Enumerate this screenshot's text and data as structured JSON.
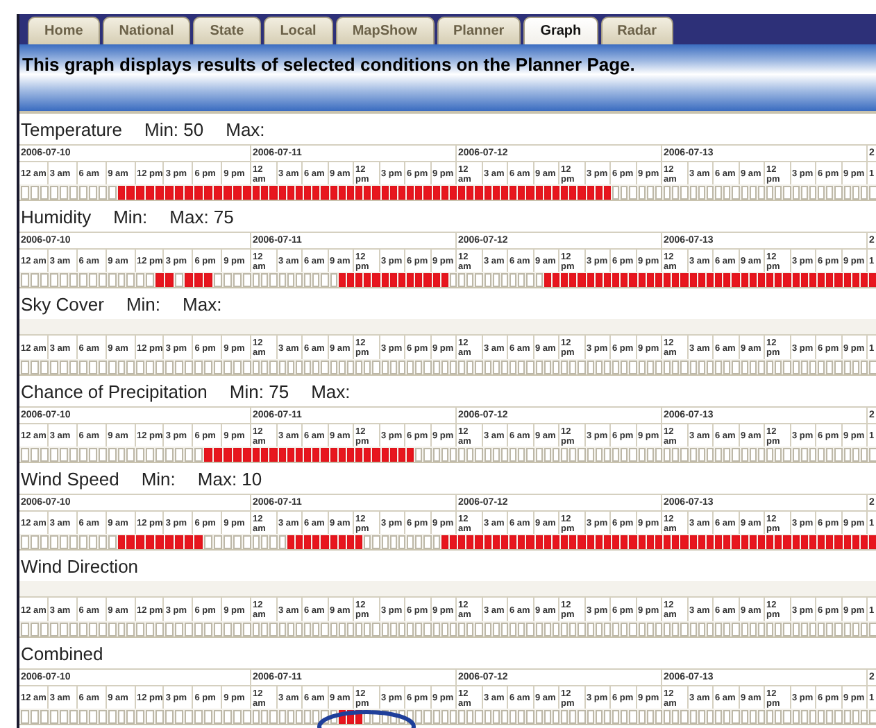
{
  "tabs": [
    {
      "label": "Home",
      "selected": false
    },
    {
      "label": "National",
      "selected": false
    },
    {
      "label": "State",
      "selected": false
    },
    {
      "label": "Local",
      "selected": false
    },
    {
      "label": "MapShow",
      "selected": false
    },
    {
      "label": "Planner",
      "selected": false
    },
    {
      "label": "Graph",
      "selected": true
    },
    {
      "label": "Radar",
      "selected": false
    }
  ],
  "banner": "This graph displays results of selected conditions on the Planner Page.",
  "conditions": [
    {
      "name": "Temperature",
      "min": "Min: 50",
      "max": "Max:",
      "days": [
        {
          "date": "2006-07-10",
          "hours": [
            "12 am",
            "3 am",
            "6 am",
            "9 am",
            "12 pm",
            "3 pm",
            "6 pm",
            "9 pm"
          ],
          "cells": [
            false,
            false,
            false,
            false,
            false,
            false,
            false,
            false,
            false,
            false,
            true,
            true,
            true,
            true,
            true,
            true,
            true,
            true,
            true,
            true,
            true,
            true,
            true,
            true
          ]
        },
        {
          "date": "2006-07-11",
          "hours": [
            "12 am",
            "3 am",
            "6 am",
            "9 am",
            "12 pm",
            "3 pm",
            "6 pm",
            "9 pm"
          ],
          "cells": [
            true,
            true,
            true,
            true,
            true,
            true,
            true,
            true,
            true,
            true,
            true,
            true,
            true,
            true,
            true,
            true,
            true,
            true,
            true,
            true,
            true,
            true,
            true,
            true
          ]
        },
        {
          "date": "2006-07-12",
          "hours": [
            "12 am",
            "3 am",
            "6 am",
            "9 am",
            "12 pm",
            "3 pm",
            "6 pm",
            "9 pm"
          ],
          "cells": [
            true,
            true,
            true,
            true,
            true,
            true,
            true,
            true,
            true,
            true,
            true,
            true,
            true,
            true,
            true,
            true,
            true,
            true,
            false,
            false,
            false,
            false,
            false,
            false
          ]
        },
        {
          "date": "2006-07-13",
          "hours": [
            "12 am",
            "3 am",
            "6 am",
            "9 am",
            "12 pm",
            "3 pm",
            "6 pm",
            "9 pm"
          ],
          "cells": [
            false,
            false,
            false,
            false,
            false,
            false,
            false,
            false,
            false,
            false,
            false,
            false,
            false,
            false,
            false,
            false,
            false,
            false,
            false,
            false,
            false,
            false,
            false,
            false
          ]
        },
        {
          "date": "2",
          "hours": [
            "1"
          ],
          "cells": [
            false
          ]
        }
      ]
    },
    {
      "name": "Humidity",
      "min": "Min:",
      "max": "Max: 75",
      "days": [
        {
          "date": "2006-07-10",
          "hours": [
            "12 am",
            "3 am",
            "6 am",
            "9 am",
            "12 pm",
            "3 pm",
            "6 pm",
            "9 pm"
          ],
          "cells": [
            false,
            false,
            false,
            false,
            false,
            false,
            false,
            false,
            false,
            false,
            false,
            false,
            false,
            false,
            true,
            true,
            false,
            true,
            true,
            true,
            false,
            false,
            false,
            false
          ]
        },
        {
          "date": "2006-07-11",
          "hours": [
            "12 am",
            "3 am",
            "6 am",
            "9 am",
            "12 pm",
            "3 pm",
            "6 pm",
            "9 pm"
          ],
          "cells": [
            false,
            false,
            false,
            false,
            false,
            false,
            false,
            false,
            false,
            false,
            true,
            true,
            true,
            true,
            true,
            true,
            true,
            true,
            true,
            true,
            true,
            true,
            true,
            false
          ]
        },
        {
          "date": "2006-07-12",
          "hours": [
            "12 am",
            "3 am",
            "6 am",
            "9 am",
            "12 pm",
            "3 pm",
            "6 pm",
            "9 pm"
          ],
          "cells": [
            false,
            false,
            false,
            false,
            false,
            false,
            false,
            false,
            false,
            false,
            true,
            true,
            true,
            true,
            true,
            true,
            true,
            true,
            true,
            true,
            true,
            true,
            true,
            true
          ]
        },
        {
          "date": "2006-07-13",
          "hours": [
            "12 am",
            "3 am",
            "6 am",
            "9 am",
            "12 pm",
            "3 pm",
            "6 pm",
            "9 pm"
          ],
          "cells": [
            true,
            true,
            true,
            true,
            true,
            true,
            true,
            true,
            true,
            true,
            true,
            true,
            true,
            true,
            true,
            true,
            true,
            true,
            true,
            true,
            true,
            true,
            true,
            true
          ]
        },
        {
          "date": "2",
          "hours": [
            "1"
          ],
          "cells": [
            true
          ]
        }
      ]
    },
    {
      "name": "Sky Cover",
      "min": "Min:",
      "max": "Max:",
      "days": [
        {
          "hours": [
            "12 am",
            "3 am",
            "6 am",
            "9 am",
            "12 pm",
            "3 pm",
            "6 pm",
            "9 pm"
          ],
          "cells": [
            false,
            false,
            false,
            false,
            false,
            false,
            false,
            false,
            false,
            false,
            false,
            false,
            false,
            false,
            false,
            false,
            false,
            false,
            false,
            false,
            false,
            false,
            false,
            false
          ]
        },
        {
          "hours": [
            "12 am",
            "3 am",
            "6 am",
            "9 am",
            "12 pm",
            "3 pm",
            "6 pm",
            "9 pm"
          ],
          "cells": [
            false,
            false,
            false,
            false,
            false,
            false,
            false,
            false,
            false,
            false,
            false,
            false,
            false,
            false,
            false,
            false,
            false,
            false,
            false,
            false,
            false,
            false,
            false,
            false
          ]
        },
        {
          "hours": [
            "12 am",
            "3 am",
            "6 am",
            "9 am",
            "12 pm",
            "3 pm",
            "6 pm",
            "9 pm"
          ],
          "cells": [
            false,
            false,
            false,
            false,
            false,
            false,
            false,
            false,
            false,
            false,
            false,
            false,
            false,
            false,
            false,
            false,
            false,
            false,
            false,
            false,
            false,
            false,
            false,
            false
          ]
        },
        {
          "hours": [
            "12 am",
            "3 am",
            "6 am",
            "9 am",
            "12 pm",
            "3 pm",
            "6 pm",
            "9 pm"
          ],
          "cells": [
            false,
            false,
            false,
            false,
            false,
            false,
            false,
            false,
            false,
            false,
            false,
            false,
            false,
            false,
            false,
            false,
            false,
            false,
            false,
            false,
            false,
            false,
            false,
            false
          ]
        },
        {
          "hours": [
            "1"
          ],
          "cells": [
            false
          ]
        }
      ]
    },
    {
      "name": "Chance of Precipitation",
      "min": "Min: 75",
      "max": "Max:",
      "days": [
        {
          "date": "2006-07-10",
          "hours": [
            "12 am",
            "3 am",
            "6 am",
            "9 am",
            "12 pm",
            "3 pm",
            "6 pm",
            "9 pm"
          ],
          "cells": [
            false,
            false,
            false,
            false,
            false,
            false,
            false,
            false,
            false,
            false,
            false,
            false,
            false,
            false,
            false,
            false,
            false,
            false,
            false,
            true,
            true,
            true,
            true,
            true
          ]
        },
        {
          "date": "2006-07-11",
          "hours": [
            "12 am",
            "3 am",
            "6 am",
            "9 am",
            "12 pm",
            "3 pm",
            "6 pm",
            "9 pm"
          ],
          "cells": [
            true,
            true,
            true,
            true,
            true,
            true,
            true,
            true,
            true,
            true,
            true,
            true,
            true,
            true,
            true,
            true,
            true,
            true,
            true,
            false,
            false,
            false,
            false,
            false
          ]
        },
        {
          "date": "2006-07-12",
          "hours": [
            "12 am",
            "3 am",
            "6 am",
            "9 am",
            "12 pm",
            "3 pm",
            "6 pm",
            "9 pm"
          ],
          "cells": [
            false,
            false,
            false,
            false,
            false,
            false,
            false,
            false,
            false,
            false,
            false,
            false,
            false,
            false,
            false,
            false,
            false,
            false,
            false,
            false,
            false,
            false,
            false,
            false
          ]
        },
        {
          "date": "2006-07-13",
          "hours": [
            "12 am",
            "3 am",
            "6 am",
            "9 am",
            "12 pm",
            "3 pm",
            "6 pm",
            "9 pm"
          ],
          "cells": [
            false,
            false,
            false,
            false,
            false,
            false,
            false,
            false,
            false,
            false,
            false,
            false,
            false,
            false,
            false,
            false,
            false,
            false,
            false,
            false,
            false,
            false,
            false,
            false
          ]
        },
        {
          "date": "2",
          "hours": [
            "1"
          ],
          "cells": [
            false
          ]
        }
      ]
    },
    {
      "name": "Wind Speed",
      "min": "Min:",
      "max": "Max: 10",
      "days": [
        {
          "date": "2006-07-10",
          "hours": [
            "12 am",
            "3 am",
            "6 am",
            "9 am",
            "12 pm",
            "3 pm",
            "6 pm",
            "9 pm"
          ],
          "cells": [
            false,
            false,
            false,
            false,
            false,
            false,
            false,
            false,
            false,
            false,
            true,
            true,
            true,
            true,
            true,
            true,
            true,
            true,
            true,
            false,
            false,
            false,
            false,
            false
          ]
        },
        {
          "date": "2006-07-11",
          "hours": [
            "12 am",
            "3 am",
            "6 am",
            "9 am",
            "12 pm",
            "3 pm",
            "6 pm",
            "9 pm"
          ],
          "cells": [
            false,
            false,
            false,
            false,
            true,
            true,
            true,
            true,
            true,
            true,
            true,
            true,
            true,
            false,
            false,
            false,
            false,
            false,
            false,
            false,
            false,
            false,
            true,
            true
          ]
        },
        {
          "date": "2006-07-12",
          "hours": [
            "12 am",
            "3 am",
            "6 am",
            "9 am",
            "12 pm",
            "3 pm",
            "6 pm",
            "9 pm"
          ],
          "cells": [
            true,
            true,
            true,
            true,
            true,
            true,
            true,
            true,
            true,
            true,
            true,
            true,
            true,
            true,
            true,
            true,
            true,
            true,
            true,
            true,
            true,
            true,
            true,
            true
          ]
        },
        {
          "date": "2006-07-13",
          "hours": [
            "12 am",
            "3 am",
            "6 am",
            "9 am",
            "12 pm",
            "3 pm",
            "6 pm",
            "9 pm"
          ],
          "cells": [
            true,
            true,
            true,
            true,
            true,
            true,
            true,
            true,
            true,
            true,
            true,
            true,
            true,
            true,
            true,
            true,
            true,
            true,
            true,
            true,
            true,
            true,
            true,
            true
          ]
        },
        {
          "date": "2",
          "hours": [
            "1"
          ],
          "cells": [
            true
          ]
        }
      ]
    },
    {
      "name": "Wind Direction",
      "days": [
        {
          "hours": [
            "12 am",
            "3 am",
            "6 am",
            "9 am",
            "12 pm",
            "3 pm",
            "6 pm",
            "9 pm"
          ],
          "cells": [
            false,
            false,
            false,
            false,
            false,
            false,
            false,
            false,
            false,
            false,
            false,
            false,
            false,
            false,
            false,
            false,
            false,
            false,
            false,
            false,
            false,
            false,
            false,
            false
          ]
        },
        {
          "hours": [
            "12 am",
            "3 am",
            "6 am",
            "9 am",
            "12 pm",
            "3 pm",
            "6 pm",
            "9 pm"
          ],
          "cells": [
            false,
            false,
            false,
            false,
            false,
            false,
            false,
            false,
            false,
            false,
            false,
            false,
            false,
            false,
            false,
            false,
            false,
            false,
            false,
            false,
            false,
            false,
            false,
            false
          ]
        },
        {
          "hours": [
            "12 am",
            "3 am",
            "6 am",
            "9 am",
            "12 pm",
            "3 pm",
            "6 pm",
            "9 pm"
          ],
          "cells": [
            false,
            false,
            false,
            false,
            false,
            false,
            false,
            false,
            false,
            false,
            false,
            false,
            false,
            false,
            false,
            false,
            false,
            false,
            false,
            false,
            false,
            false,
            false,
            false
          ]
        },
        {
          "hours": [
            "12 am",
            "3 am",
            "6 am",
            "9 am",
            "12 pm",
            "3 pm",
            "6 pm",
            "9 pm"
          ],
          "cells": [
            false,
            false,
            false,
            false,
            false,
            false,
            false,
            false,
            false,
            false,
            false,
            false,
            false,
            false,
            false,
            false,
            false,
            false,
            false,
            false,
            false,
            false,
            false,
            false
          ]
        },
        {
          "hours": [
            "1"
          ],
          "cells": [
            false
          ]
        }
      ]
    },
    {
      "name": "Combined",
      "highlighted": true,
      "days": [
        {
          "date": "2006-07-10",
          "hours": [
            "12 am",
            "3 am",
            "6 am",
            "9 am",
            "12 pm",
            "3 pm",
            "6 pm",
            "9 pm"
          ],
          "cells": [
            false,
            false,
            false,
            false,
            false,
            false,
            false,
            false,
            false,
            false,
            false,
            false,
            false,
            false,
            false,
            false,
            false,
            false,
            false,
            false,
            false,
            false,
            false,
            false
          ]
        },
        {
          "date": "2006-07-11",
          "hours": [
            "12 am",
            "3 am",
            "6 am",
            "9 am",
            "12 pm",
            "3 pm",
            "6 pm",
            "9 pm"
          ],
          "cells": [
            false,
            false,
            false,
            false,
            false,
            false,
            false,
            false,
            false,
            false,
            true,
            true,
            true,
            false,
            false,
            false,
            false,
            false,
            false,
            false,
            false,
            false,
            false,
            false
          ]
        },
        {
          "date": "2006-07-12",
          "hours": [
            "12 am",
            "3 am",
            "6 am",
            "9 am",
            "12 pm",
            "3 pm",
            "6 pm",
            "9 pm"
          ],
          "cells": [
            false,
            false,
            false,
            false,
            false,
            false,
            false,
            false,
            false,
            false,
            false,
            false,
            false,
            false,
            false,
            false,
            false,
            false,
            false,
            false,
            false,
            false,
            false,
            false
          ]
        },
        {
          "date": "2006-07-13",
          "hours": [
            "12 am",
            "3 am",
            "6 am",
            "9 am",
            "12 pm",
            "3 pm",
            "6 pm",
            "9 pm"
          ],
          "cells": [
            false,
            false,
            false,
            false,
            false,
            false,
            false,
            false,
            false,
            false,
            false,
            false,
            false,
            false,
            false,
            false,
            false,
            false,
            false,
            false,
            false,
            false,
            false,
            false
          ]
        },
        {
          "date": "2",
          "hours": [
            "1"
          ],
          "cells": [
            false
          ]
        }
      ]
    }
  ]
}
